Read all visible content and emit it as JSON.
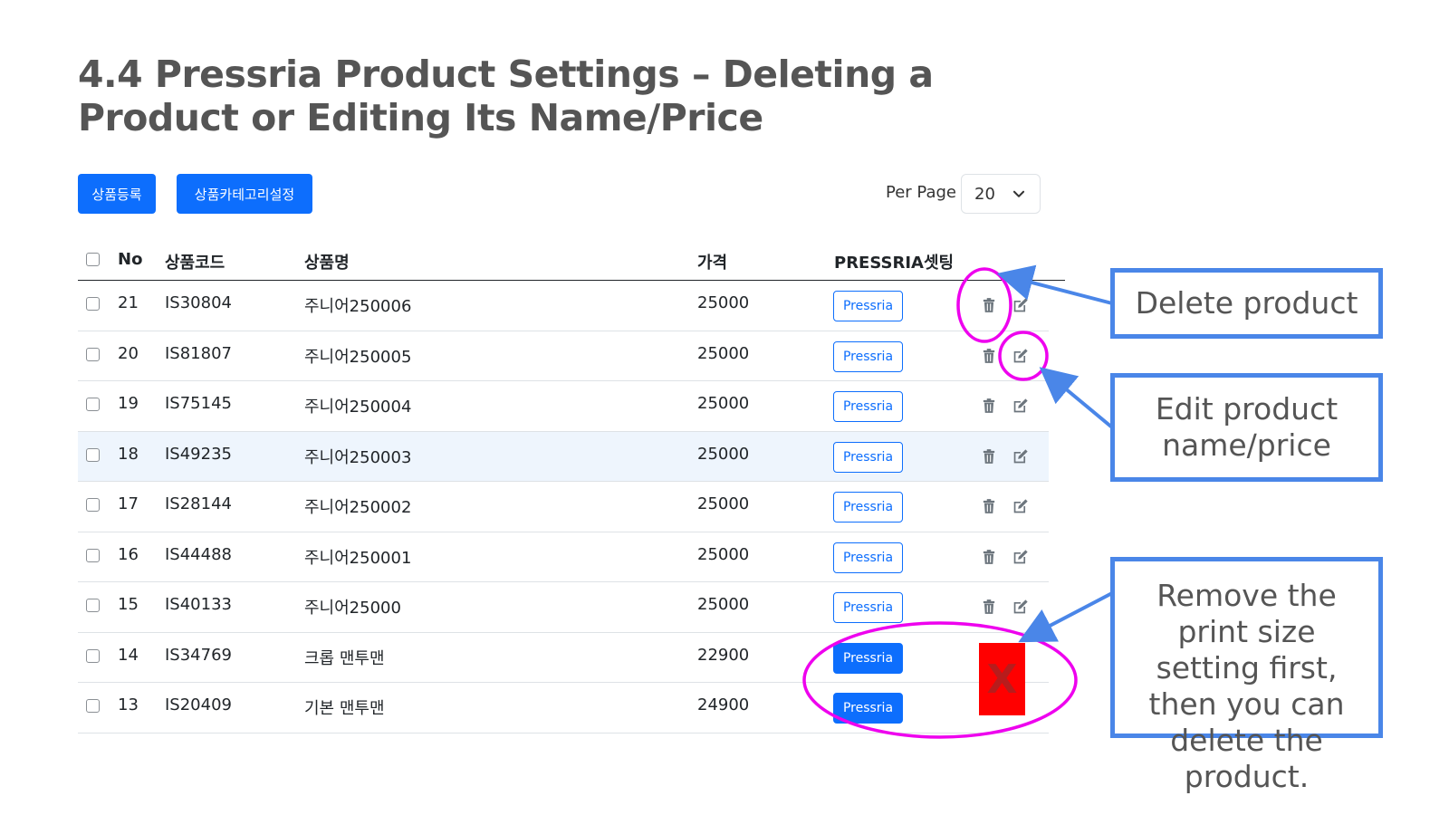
{
  "title": "4.4  Pressria Product Settings – Deleting a Product or Editing Its Name/Price",
  "toolbar": {
    "register_label": "상품등록",
    "category_label": "상품카테고리설정",
    "per_page_label": "Per Page",
    "per_page_value": "20"
  },
  "table": {
    "headers": {
      "no": "No",
      "code": "상품코드",
      "name": "상품명",
      "price": "가격",
      "pressria": "PRESSRIA셋팅"
    },
    "rows": [
      {
        "no": "21",
        "code": "IS30804",
        "name": "주니어250006",
        "price": "25000",
        "pressria": "Pressria"
      },
      {
        "no": "20",
        "code": "IS81807",
        "name": "주니어250005",
        "price": "25000",
        "pressria": "Pressria"
      },
      {
        "no": "19",
        "code": "IS75145",
        "name": "주니어250004",
        "price": "25000",
        "pressria": "Pressria"
      },
      {
        "no": "18",
        "code": "IS49235",
        "name": "주니어250003",
        "price": "25000",
        "pressria": "Pressria"
      },
      {
        "no": "17",
        "code": "IS28144",
        "name": "주니어250002",
        "price": "25000",
        "pressria": "Pressria"
      },
      {
        "no": "16",
        "code": "IS44488",
        "name": "주니어250001",
        "price": "25000",
        "pressria": "Pressria"
      },
      {
        "no": "15",
        "code": "IS40133",
        "name": "주니어25000",
        "price": "25000",
        "pressria": "Pressria"
      },
      {
        "no": "14",
        "code": "IS34769",
        "name": "크롭 맨투맨",
        "price": "22900",
        "pressria": "Pressria"
      },
      {
        "no": "13",
        "code": "IS20409",
        "name": "기본 맨투맨",
        "price": "24900",
        "pressria": "Pressria"
      }
    ]
  },
  "annotations": {
    "delete": "Delete product",
    "edit": "Edit product name/price",
    "remove": "Remove the print size setting first, then you can delete the product.",
    "x_mark": "X"
  },
  "colors": {
    "primary": "#0d6efd",
    "callout_border": "#4a86e8",
    "highlight_circle": "#ee00ee",
    "red_box": "#ff0000"
  },
  "icons": [
    "chevron-down-icon",
    "trash-icon",
    "edit-icon"
  ]
}
